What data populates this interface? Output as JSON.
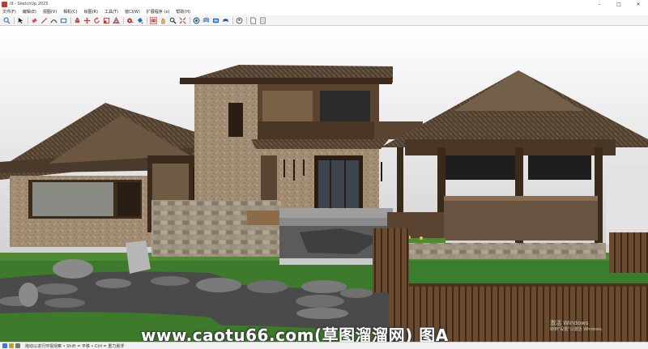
{
  "window": {
    "title": "i9 - SketchUp 2025"
  },
  "menu": [
    "文件(F)",
    "编辑(E)",
    "视图(V)",
    "相机(C)",
    "绘图(R)",
    "工具(T)",
    "窗口(W)",
    "扩展程序 (x)",
    "帮助(H)"
  ],
  "toolbar": {
    "tools": [
      {
        "name": "search-icon",
        "group": 0
      },
      {
        "name": "select-icon",
        "group": 1
      },
      {
        "name": "eraser-icon",
        "group": 2
      },
      {
        "name": "line-icon",
        "group": 2
      },
      {
        "name": "arc-icon",
        "group": 2
      },
      {
        "name": "rectangle-icon",
        "group": 2
      },
      {
        "name": "push-pull-icon",
        "group": 3
      },
      {
        "name": "move-icon",
        "group": 3
      },
      {
        "name": "rotate-icon",
        "group": 3
      },
      {
        "name": "scale-icon",
        "group": 3
      },
      {
        "name": "offset-icon",
        "group": 3
      },
      {
        "name": "tape-measure-icon",
        "group": 4
      },
      {
        "name": "paint-bucket-icon",
        "group": 4
      },
      {
        "name": "orbit-icon",
        "group": 5
      },
      {
        "name": "pan-icon",
        "group": 5
      },
      {
        "name": "zoom-icon",
        "group": 5
      },
      {
        "name": "zoom-extents-icon",
        "group": 5
      },
      {
        "name": "warehouse-icon",
        "group": 6
      },
      {
        "name": "extension-icon",
        "group": 6
      },
      {
        "name": "layout-icon",
        "group": 6
      },
      {
        "name": "styles-icon",
        "group": 6
      },
      {
        "name": "account-icon",
        "group": 7
      },
      {
        "name": "document-icon",
        "group": 8
      },
      {
        "name": "page-icon",
        "group": 8
      }
    ]
  },
  "watermark": "www.caotu66.com(草图溜溜网) 图A",
  "activation": {
    "line1": "激活 Windows",
    "line2": "转到\"设置\"以激活 Windows。"
  },
  "status": {
    "hint": "拖动以进行环视观察 • Shift = 平移 • Ctrl = 重力悬浮"
  },
  "colors": {
    "sky": "#d9d9d9",
    "roof": "#5a4836",
    "wall_stone": "#a7907a",
    "wood": "#4d3a2a",
    "grass": "#3f7a2b",
    "path": "#4e4e4e"
  }
}
